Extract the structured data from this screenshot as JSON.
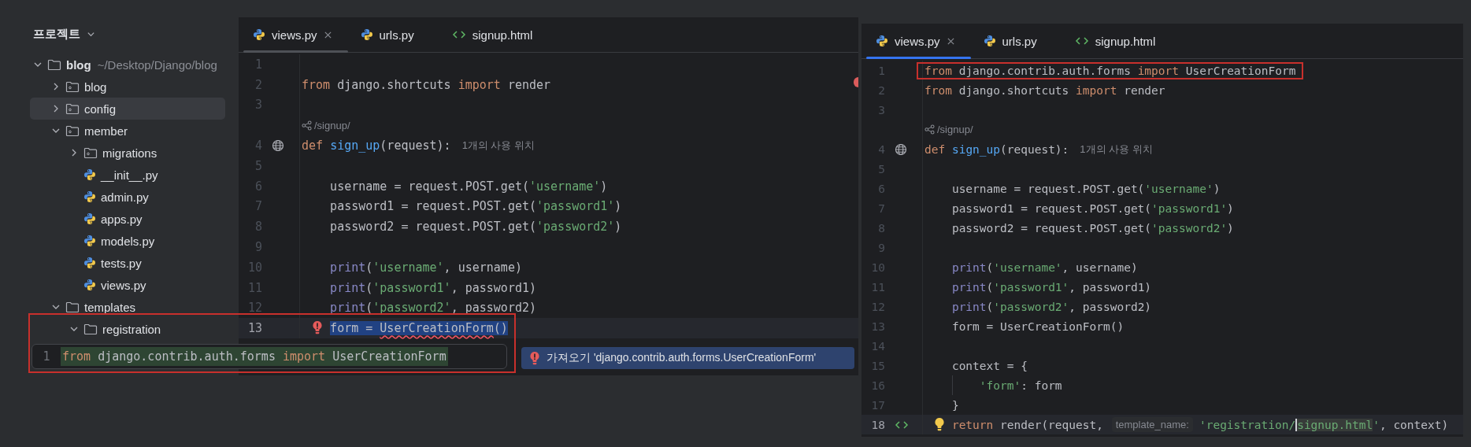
{
  "project_panel": {
    "title": "프로젝트",
    "tree": [
      {
        "name": "blog",
        "path": "~/Desktop/Django/blog",
        "kind": "folder",
        "expanded": true,
        "selected": false,
        "children": [
          {
            "name": "blog",
            "kind": "package",
            "expanded": false,
            "selected": false
          },
          {
            "name": "config",
            "kind": "package",
            "expanded": false,
            "selected": true
          },
          {
            "name": "member",
            "kind": "package",
            "expanded": true,
            "selected": false,
            "children": [
              {
                "name": "migrations",
                "kind": "package",
                "expanded": false,
                "selected": false
              },
              {
                "name": "__init__.py",
                "kind": "python",
                "selected": false
              },
              {
                "name": "admin.py",
                "kind": "python",
                "selected": false
              },
              {
                "name": "apps.py",
                "kind": "python",
                "selected": false
              },
              {
                "name": "models.py",
                "kind": "python",
                "selected": false
              },
              {
                "name": "tests.py",
                "kind": "python",
                "selected": false
              },
              {
                "name": "views.py",
                "kind": "python",
                "selected": false
              }
            ]
          },
          {
            "name": "templates",
            "kind": "folder",
            "expanded": true,
            "selected": false,
            "children": [
              {
                "name": "registration",
                "kind": "folder",
                "expanded": true,
                "selected": false
              }
            ]
          }
        ]
      }
    ]
  },
  "left_editor": {
    "focused": false,
    "error_stripe": true,
    "tabs": [
      {
        "label": "views.py",
        "kind": "python",
        "selected": true
      },
      {
        "label": "urls.py",
        "kind": "python",
        "selected": false
      },
      {
        "label": "signup.html",
        "kind": "html",
        "selected": false
      }
    ],
    "lines": [
      {
        "kind": "code",
        "number": "1",
        "current": false
      },
      {
        "kind": "code",
        "number": "2",
        "current": false,
        "tokens": [
          {
            "kind": "keyword",
            "text": "from "
          },
          {
            "kind": "plain",
            "text": "django.shortcuts "
          },
          {
            "kind": "keyword",
            "text": "import "
          },
          {
            "kind": "plain",
            "text": "render"
          }
        ]
      },
      {
        "kind": "code",
        "number": "3",
        "current": false
      },
      {
        "kind": "route",
        "text": "/signup/"
      },
      {
        "kind": "code",
        "number": "4",
        "gutter": {
          "kind": "globe"
        },
        "current": false,
        "tokens": [
          {
            "kind": "keyword",
            "text": "def "
          },
          {
            "kind": "function",
            "text": "sign_up"
          },
          {
            "kind": "plain",
            "text": "(request):"
          },
          {
            "kind": "hint",
            "text": "1개의 사용 위치"
          }
        ],
        "children": [
          {
            "kind": "code",
            "number": "5",
            "current": false
          },
          {
            "kind": "code",
            "number": "6",
            "current": false,
            "tokens": [
              {
                "kind": "plain",
                "text": "username = request.POST.get("
              },
              {
                "kind": "string",
                "text": "'username'"
              },
              {
                "kind": "plain",
                "text": ")"
              }
            ]
          },
          {
            "kind": "code",
            "number": "7",
            "current": false,
            "tokens": [
              {
                "kind": "plain",
                "text": "password1 = request.POST.get("
              },
              {
                "kind": "string",
                "text": "'password1'"
              },
              {
                "kind": "plain",
                "text": ")"
              }
            ]
          },
          {
            "kind": "code",
            "number": "8",
            "current": false,
            "tokens": [
              {
                "kind": "plain",
                "text": "password2 = request.POST.get("
              },
              {
                "kind": "string",
                "text": "'password2'"
              },
              {
                "kind": "plain",
                "text": ")"
              }
            ]
          },
          {
            "kind": "code",
            "number": "9",
            "current": false
          },
          {
            "kind": "code",
            "number": "10",
            "current": false,
            "tokens": [
              {
                "kind": "builtin",
                "text": "print"
              },
              {
                "kind": "plain",
                "text": "("
              },
              {
                "kind": "string",
                "text": "'username'"
              },
              {
                "kind": "plain",
                "text": ", username)"
              }
            ]
          },
          {
            "kind": "code",
            "number": "11",
            "current": false,
            "tokens": [
              {
                "kind": "builtin",
                "text": "print"
              },
              {
                "kind": "plain",
                "text": "("
              },
              {
                "kind": "string",
                "text": "'password1'"
              },
              {
                "kind": "plain",
                "text": ", password1)"
              }
            ]
          },
          {
            "kind": "code",
            "number": "12",
            "current": false,
            "tokens": [
              {
                "kind": "builtin",
                "text": "print"
              },
              {
                "kind": "plain",
                "text": "("
              },
              {
                "kind": "string",
                "text": "'password2'"
              },
              {
                "kind": "plain",
                "text": ", password2)"
              }
            ]
          },
          {
            "kind": "code",
            "number": "13",
            "current": true,
            "selected": true,
            "marker": {
              "kind": "error"
            },
            "tokens": [
              {
                "kind": "plain",
                "text": "form = "
              },
              {
                "kind": "unresolved",
                "text": "UserCreationForm"
              },
              {
                "kind": "plain",
                "text": "()"
              }
            ]
          }
        ]
      }
    ]
  },
  "import_popup": {
    "annotated": true,
    "number": "1",
    "tokens": [
      {
        "kind": "keyword",
        "text": "from "
      },
      {
        "kind": "plain",
        "text": "django.contrib.auth.forms "
      },
      {
        "kind": "keyword",
        "text": "import "
      },
      {
        "kind": "plain",
        "text": "UserCreationForm"
      }
    ]
  },
  "import_tooltip": {
    "text": "가져오기 'django.contrib.auth.forms.UserCreationForm'"
  },
  "right_editor": {
    "focused": true,
    "tabs": [
      {
        "label": "views.py",
        "kind": "python",
        "selected": true
      },
      {
        "label": "urls.py",
        "kind": "python",
        "selected": false
      },
      {
        "label": "signup.html",
        "kind": "html",
        "selected": false
      }
    ],
    "lines": [
      {
        "kind": "code",
        "number": "1",
        "current": false,
        "annotated": true,
        "tokens": [
          {
            "kind": "keyword",
            "text": "from "
          },
          {
            "kind": "plain",
            "text": "django.contrib.auth.forms "
          },
          {
            "kind": "keyword",
            "text": "import "
          },
          {
            "kind": "plain",
            "text": "UserCreationForm"
          }
        ]
      },
      {
        "kind": "code",
        "number": "2",
        "current": false,
        "tokens": [
          {
            "kind": "keyword",
            "text": "from "
          },
          {
            "kind": "plain",
            "text": "django.shortcuts "
          },
          {
            "kind": "keyword",
            "text": "import "
          },
          {
            "kind": "plain",
            "text": "render"
          }
        ]
      },
      {
        "kind": "code",
        "number": "3",
        "current": false
      },
      {
        "kind": "route",
        "text": "/signup/"
      },
      {
        "kind": "code",
        "number": "4",
        "gutter": {
          "kind": "globe"
        },
        "current": false,
        "tokens": [
          {
            "kind": "keyword",
            "text": "def "
          },
          {
            "kind": "function",
            "text": "sign_up"
          },
          {
            "kind": "plain",
            "text": "(request):"
          },
          {
            "kind": "hint",
            "text": "1개의 사용 위치"
          }
        ],
        "children": [
          {
            "kind": "code",
            "number": "5",
            "current": false
          },
          {
            "kind": "code",
            "number": "6",
            "current": false,
            "tokens": [
              {
                "kind": "plain",
                "text": "username = request.POST.get("
              },
              {
                "kind": "string",
                "text": "'username'"
              },
              {
                "kind": "plain",
                "text": ")"
              }
            ]
          },
          {
            "kind": "code",
            "number": "7",
            "current": false,
            "tokens": [
              {
                "kind": "plain",
                "text": "password1 = request.POST.get("
              },
              {
                "kind": "string",
                "text": "'password1'"
              },
              {
                "kind": "plain",
                "text": ")"
              }
            ]
          },
          {
            "kind": "code",
            "number": "8",
            "current": false,
            "tokens": [
              {
                "kind": "plain",
                "text": "password2 = request.POST.get("
              },
              {
                "kind": "string",
                "text": "'password2'"
              },
              {
                "kind": "plain",
                "text": ")"
              }
            ]
          },
          {
            "kind": "code",
            "number": "9",
            "current": false
          },
          {
            "kind": "code",
            "number": "10",
            "current": false,
            "tokens": [
              {
                "kind": "builtin",
                "text": "print"
              },
              {
                "kind": "plain",
                "text": "("
              },
              {
                "kind": "string",
                "text": "'username'"
              },
              {
                "kind": "plain",
                "text": ", username)"
              }
            ]
          },
          {
            "kind": "code",
            "number": "11",
            "current": false,
            "tokens": [
              {
                "kind": "builtin",
                "text": "print"
              },
              {
                "kind": "plain",
                "text": "("
              },
              {
                "kind": "string",
                "text": "'password1'"
              },
              {
                "kind": "plain",
                "text": ", password1)"
              }
            ]
          },
          {
            "kind": "code",
            "number": "12",
            "current": false,
            "tokens": [
              {
                "kind": "builtin",
                "text": "print"
              },
              {
                "kind": "plain",
                "text": "("
              },
              {
                "kind": "string",
                "text": "'password2'"
              },
              {
                "kind": "plain",
                "text": ", password2)"
              }
            ]
          },
          {
            "kind": "code",
            "number": "13",
            "current": false,
            "tokens": [
              {
                "kind": "plain",
                "text": "form = UserCreationForm()"
              }
            ]
          },
          {
            "kind": "code",
            "number": "14",
            "current": false
          },
          {
            "kind": "code",
            "number": "15",
            "current": false,
            "tokens": [
              {
                "kind": "plain",
                "text": "context = {"
              }
            ],
            "children": [
              {
                "kind": "code",
                "number": "16",
                "current": false,
                "tokens": [
                  {
                    "kind": "string",
                    "text": "'form'"
                  },
                  {
                    "kind": "plain",
                    "text": ": form"
                  }
                ]
              }
            ]
          },
          {
            "kind": "code",
            "number": "17",
            "current": false,
            "tokens": [
              {
                "kind": "plain",
                "text": "}"
              }
            ]
          },
          {
            "kind": "code",
            "number": "18",
            "gutter": {
              "kind": "html"
            },
            "marker": {
              "kind": "bulb"
            },
            "current": true,
            "tokens": [
              {
                "kind": "keyword",
                "text": "return "
              },
              {
                "kind": "plain",
                "text": "render(request, "
              },
              {
                "kind": "parameter_hint",
                "text": "template_name:"
              },
              {
                "kind": "string",
                "text": "'registration/"
              },
              {
                "kind": "string",
                "text": "signup.html",
                "caret_before": true,
                "highlighted": true
              },
              {
                "kind": "string",
                "text": "'"
              },
              {
                "kind": "plain",
                "text": ", context)"
              }
            ]
          }
        ]
      }
    ]
  }
}
